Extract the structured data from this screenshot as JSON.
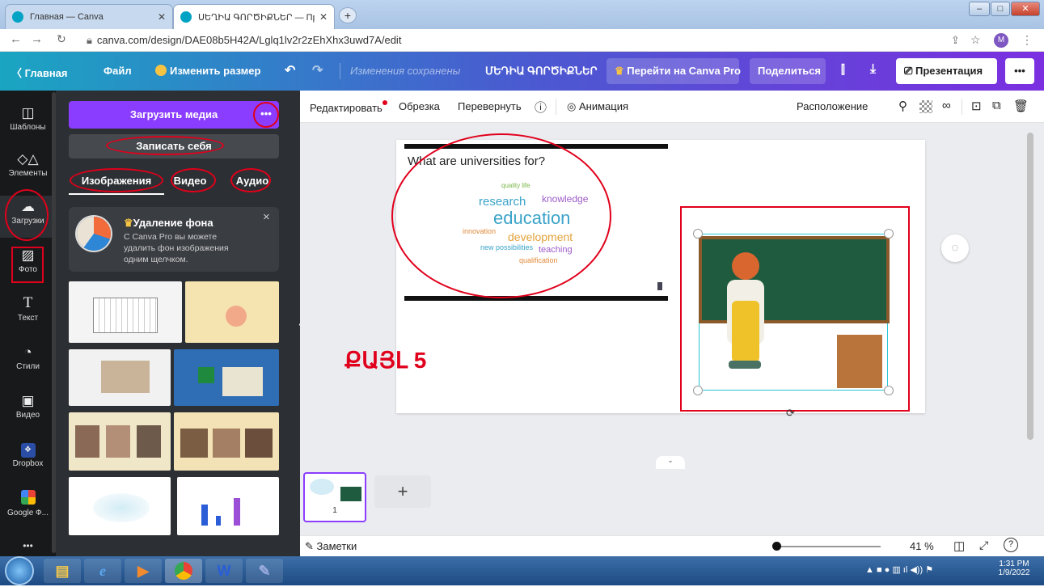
{
  "browser": {
    "tabs": [
      {
        "title": "Главная — Canva",
        "active": false
      },
      {
        "title": "ՍԵՂԻԱ ԳՈՐԾԻՔՆԵՐ — Презе",
        "active": true
      }
    ],
    "new_tab_symbol": "+",
    "url": "canva.com/design/DAE08b5H42A/Lglq1lv2r2zEhXhx3uwd7A/edit",
    "profile_initial": "M",
    "window_buttons": [
      "–",
      "□",
      "✕"
    ]
  },
  "header": {
    "back_label": "Главная",
    "file_label": "Файл",
    "resize_label": "Изменить размер",
    "saved_status": "Изменения сохранены",
    "doc_title": "ՄԵԴԻԱ ԳՈՐԾԻՔՆԵՐ",
    "pro_label": "Перейти на Canva Pro",
    "share_label": "Поделиться",
    "present_label": "Презентация",
    "more_label": "•••"
  },
  "rail": [
    {
      "label": "Шаблоны",
      "icon": "template-icon"
    },
    {
      "label": "Элементы",
      "icon": "elements-icon"
    },
    {
      "label": "Загрузки",
      "icon": "upload-cloud-icon"
    },
    {
      "label": "Фото",
      "icon": "photo-icon"
    },
    {
      "label": "Текст",
      "icon": "text-icon"
    },
    {
      "label": "Стили",
      "icon": "palette-icon"
    },
    {
      "label": "Видео",
      "icon": "video-icon"
    },
    {
      "label": "Dropbox",
      "icon": "dropbox-icon"
    },
    {
      "label": "Google Ф...",
      "icon": "google-photos-icon"
    },
    {
      "label": "•••",
      "icon": "more-icon"
    }
  ],
  "panel": {
    "upload_label": "Загрузить медиа",
    "upload_more": "•••",
    "record_label": "Записать себя",
    "tabs": [
      "Изображения",
      "Видео",
      "Аудио"
    ],
    "bg_remove_title": "Удаление фона",
    "bg_remove_text": "С Canva Pro вы можете удалить фон изображения одним щелчком.",
    "close_symbol": "×"
  },
  "toolbar": {
    "edit_label": "Редактировать",
    "crop_label": "Обрезка",
    "flip_label": "Перевернуть",
    "animate_label": "Анимация",
    "position_label": "Расположение"
  },
  "slide": {
    "title": "What are universities for?",
    "words": [
      {
        "text": "research",
        "color": "#3aa3c9"
      },
      {
        "text": "knowledge",
        "color": "#9c5cc8"
      },
      {
        "text": "education",
        "color": "#3aa3c9"
      },
      {
        "text": "innovation",
        "color": "#e28a3a"
      },
      {
        "text": "development",
        "color": "#e2a23a"
      },
      {
        "text": "new possibilities",
        "color": "#3aa3c9"
      },
      {
        "text": "teaching",
        "color": "#9c5cc8"
      },
      {
        "text": "qualification",
        "color": "#e28a3a"
      },
      {
        "text": "quality life",
        "color": "#7ab648"
      }
    ],
    "caption": "ՔԱՅԼ 5"
  },
  "pages": {
    "page_number": "1",
    "add_symbol": "+"
  },
  "footer": {
    "notes_label": "Заметки",
    "zoom": "41 %",
    "help_symbol": "?"
  },
  "taskbar": {
    "time": "1:31 PM",
    "date": "1/9/2022"
  },
  "colors": {
    "accent_purple": "#8b3dff",
    "annotation_red": "#e0001b",
    "rail_bg": "#18191b",
    "panel_bg": "#2c2f33"
  }
}
